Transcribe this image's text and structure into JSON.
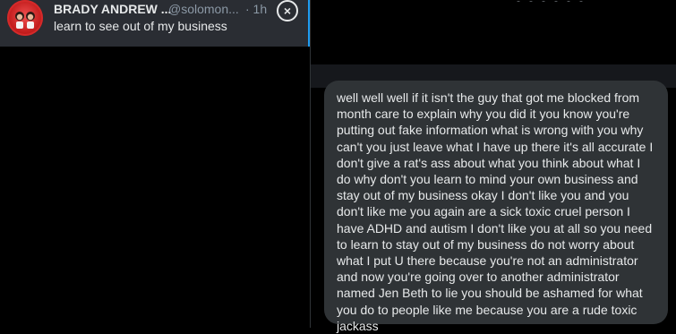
{
  "notification": {
    "author_name": "BRADY ANDREW ...",
    "handle": "@solomon...",
    "time": "· 1h",
    "text": "learn to see out of my business",
    "close_icon": "close-circle-icon"
  },
  "conversation": {
    "message": "well well well if it isn't the guy that got me blocked from month care to explain why you did it you know you're putting out fake information what is wrong with you why can't you just leave what I have up there it's all accurate I don't give a rat's ass about what you think about what I do why don't you learn to mind your own business and stay out of my business okay I don't like you and you don't like me you again are a sick toxic cruel person I have ADHD and autism I don't like you at all so you need to learn to stay out of my business do not worry about what I put U there because you're not an administrator and now you're going over to another administrator named Jen Beth to lie you should be ashamed for what you do to people like me because you are a rude toxic jackass"
  },
  "colors": {
    "background": "#000000",
    "notification_bg": "#2a2d33",
    "bubble_bg": "#2f3336",
    "accent": "#1d9bf0",
    "text_primary": "#e7e9ea",
    "text_secondary": "#8b98a5"
  }
}
